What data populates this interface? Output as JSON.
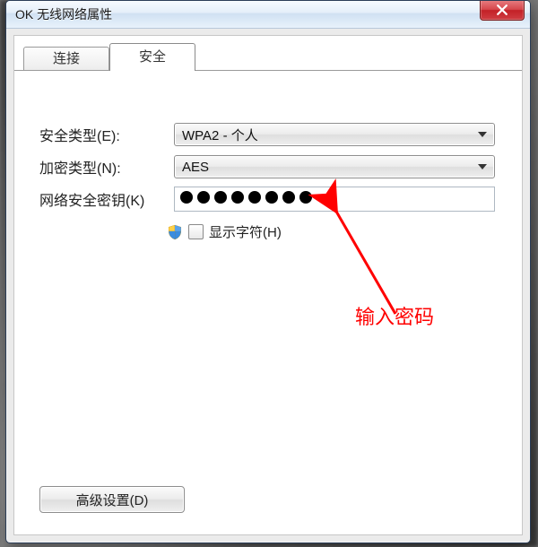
{
  "window": {
    "title": "OK 无线网络属性"
  },
  "tabs": {
    "connect": "连接",
    "security": "安全"
  },
  "form": {
    "security_type_label": "安全类型(E):",
    "security_type_value": "WPA2 - 个人",
    "encryption_label": "加密类型(N):",
    "encryption_value": "AES",
    "key_label": "网络安全密钥(K)",
    "key_mask_count": 8,
    "show_chars_label": "显示字符(H)"
  },
  "annotation": {
    "text": "输入密码"
  },
  "buttons": {
    "advanced": "高级设置(D)"
  },
  "icons": {
    "close": "close-icon",
    "dropdown": "chevron-down-icon",
    "shield": "shield-icon"
  }
}
